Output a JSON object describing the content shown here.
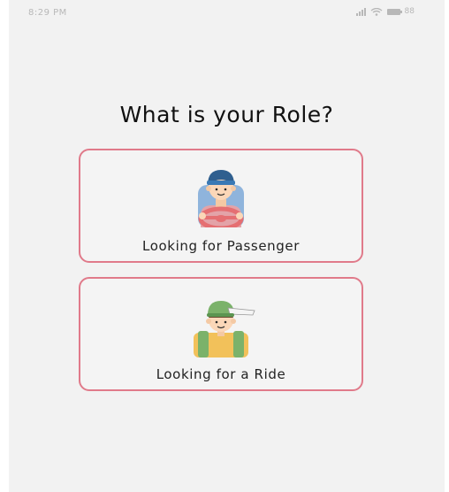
{
  "status_bar": {
    "time": "8:29 PM",
    "battery": "88"
  },
  "title": "What is your Role?",
  "roles": [
    {
      "label": "Looking for Passenger",
      "icon": "driver-icon"
    },
    {
      "label": "Looking for a Ride",
      "icon": "passenger-icon"
    }
  ],
  "colors": {
    "background": "#f2f2f2",
    "card_border": "#e07a8a",
    "title_text": "#111111"
  }
}
